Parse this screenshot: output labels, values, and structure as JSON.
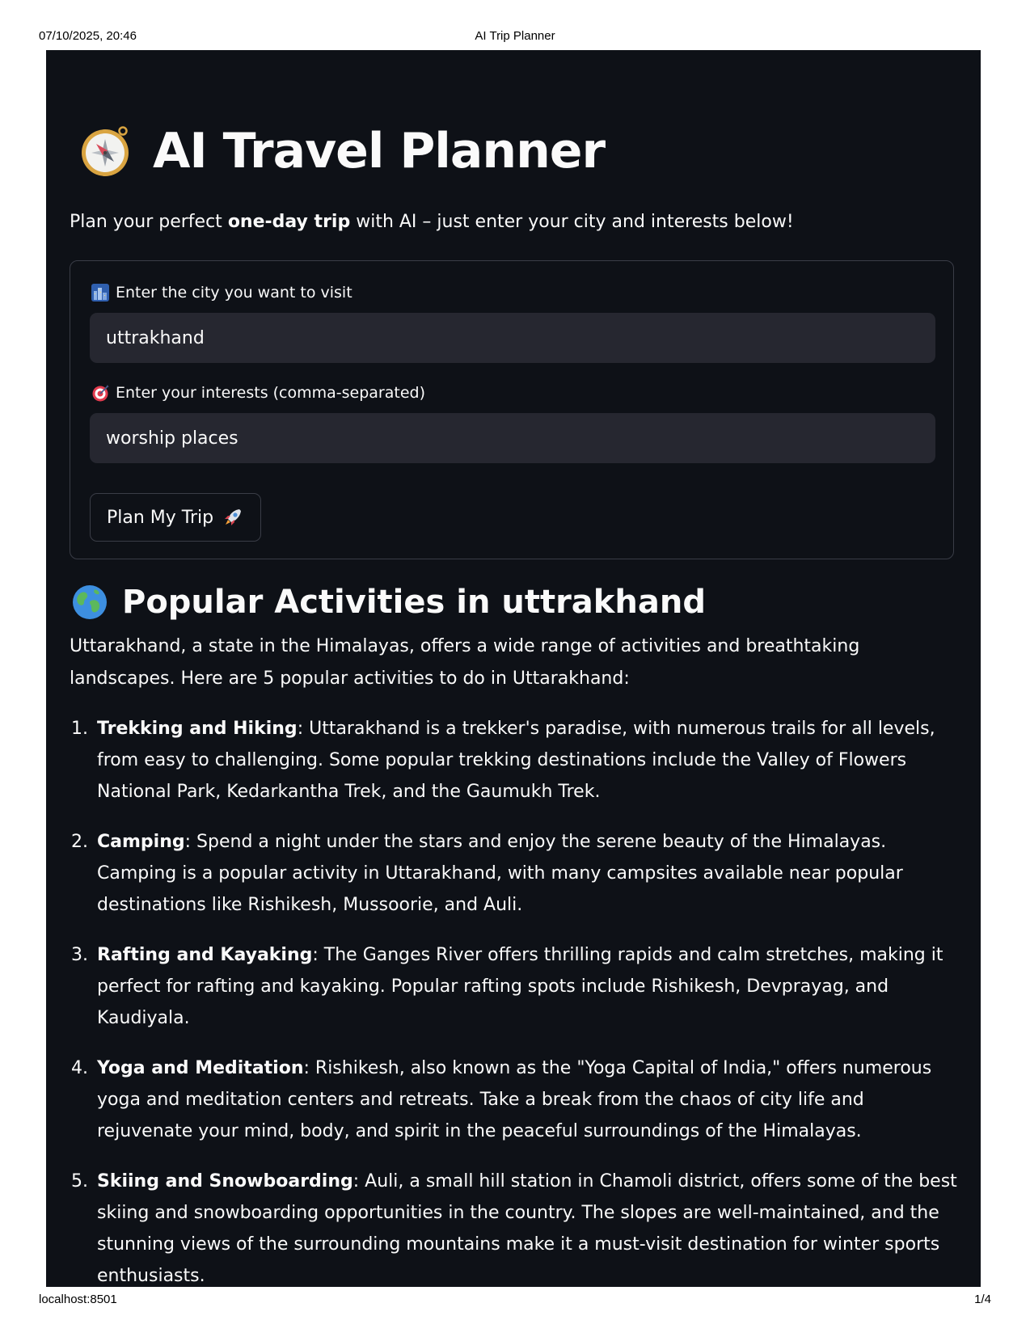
{
  "print_header": {
    "datetime": "07/10/2025, 20:46",
    "doc_title": "AI Trip Planner"
  },
  "print_footer": {
    "url": "localhost:8501",
    "page": "1/4"
  },
  "app": {
    "title": "AI Travel Planner",
    "title_icon": "compass-icon",
    "subtitle_pre": "Plan your perfect ",
    "subtitle_bold": "one-day trip",
    "subtitle_post": " with AI – just enter your city and interests below!"
  },
  "form": {
    "city_label": "Enter the city you want to visit",
    "city_icon": "cityscape-icon",
    "city_value": "uttrakhand",
    "interests_label": "Enter your interests (comma-separated)",
    "interests_icon": "target-icon",
    "interests_value": "worship places",
    "submit_label": "Plan My Trip",
    "submit_icon": "rocket-icon"
  },
  "results": {
    "heading": "Popular Activities in uttrakhand",
    "heading_icon": "globe-icon",
    "intro": "Uttarakhand, a state in the Himalayas, offers a wide range of activities and breathtaking landscapes. Here are 5 popular activities to do in Uttarakhand:",
    "activities": [
      {
        "num": "1.",
        "name": "Trekking and Hiking",
        "text": ": Uttarakhand is a trekker's paradise, with numerous trails for all levels, from easy to challenging. Some popular trekking destinations include the Valley of Flowers National Park, Kedarkantha Trek, and the Gaumukh Trek."
      },
      {
        "num": "2.",
        "name": "Camping",
        "text": ": Spend a night under the stars and enjoy the serene beauty of the Himalayas. Camping is a popular activity in Uttarakhand, with many campsites available near popular destinations like Rishikesh, Mussoorie, and Auli."
      },
      {
        "num": "3.",
        "name": "Rafting and Kayaking",
        "text": ": The Ganges River offers thrilling rapids and calm stretches, making it perfect for rafting and kayaking. Popular rafting spots include Rishikesh, Devprayag, and Kaudiyala."
      },
      {
        "num": "4.",
        "name": "Yoga and Meditation",
        "text": ": Rishikesh, also known as the \"Yoga Capital of India,\" offers numerous yoga and meditation centers and retreats. Take a break from the chaos of city life and rejuvenate your mind, body, and spirit in the peaceful surroundings of the Himalayas."
      },
      {
        "num": "5.",
        "name": "Skiing and Snowboarding",
        "text": ": Auli, a small hill station in Chamoli district, offers some of the best skiing and snowboarding opportunities in the country. The slopes are well-maintained, and the stunning views of the surrounding mountains make it a must-visit destination for winter sports enthusiasts."
      }
    ]
  }
}
